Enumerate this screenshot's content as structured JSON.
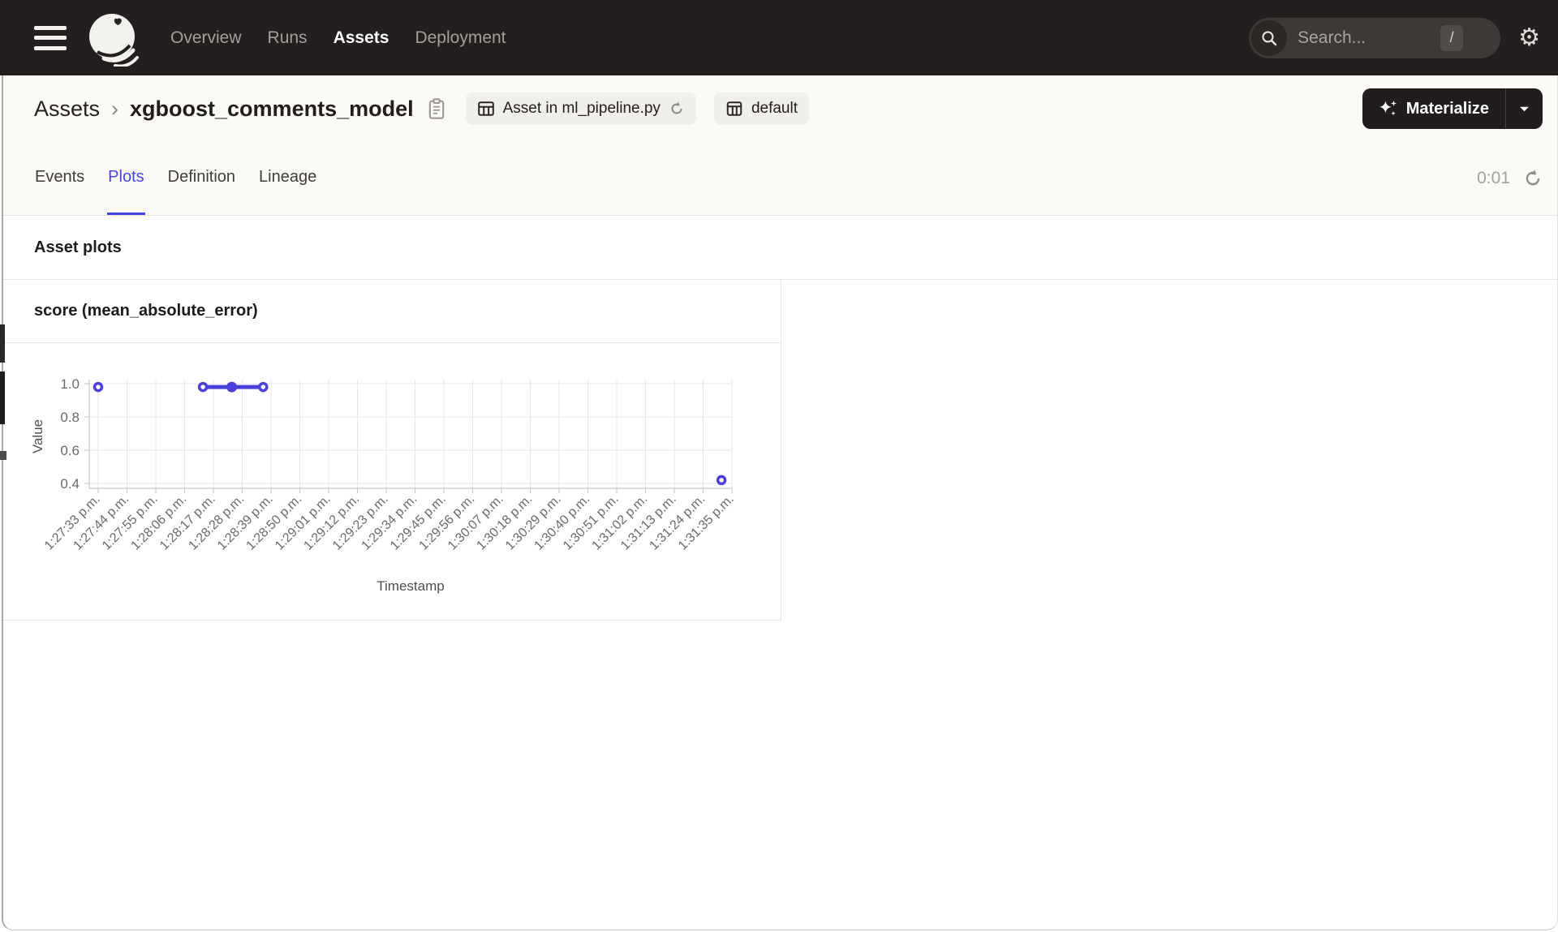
{
  "topnav": {
    "items": [
      {
        "label": "Overview",
        "active": false
      },
      {
        "label": "Runs",
        "active": false
      },
      {
        "label": "Assets",
        "active": true
      },
      {
        "label": "Deployment",
        "active": false
      }
    ],
    "search": {
      "placeholder": "Search...",
      "shortcut": "/"
    }
  },
  "header": {
    "breadcrumb": {
      "root": "Assets",
      "separator": "›",
      "current": "xgboost_comments_model"
    },
    "source_badge": {
      "label": "Asset in ml_pipeline.py"
    },
    "group_badge": {
      "label": "default"
    },
    "materialize_button": {
      "label": "Materialize"
    }
  },
  "tabs": {
    "items": [
      {
        "label": "Events",
        "active": false
      },
      {
        "label": "Plots",
        "active": true
      },
      {
        "label": "Definition",
        "active": false
      },
      {
        "label": "Lineage",
        "active": false
      }
    ],
    "timer": "0:01"
  },
  "main": {
    "section_title": "Asset plots",
    "card_title": "score (mean_absolute_error)"
  },
  "chart_data": {
    "type": "line",
    "title": "score (mean_absolute_error)",
    "xlabel": "Timestamp",
    "ylabel": "Value",
    "grid": true,
    "legend": false,
    "y_ticks": [
      "1.0",
      "0.8",
      "0.6",
      "0.4"
    ],
    "y_tick_values": [
      1.0,
      0.8,
      0.6,
      0.4
    ],
    "ylim": [
      0.35,
      1.02
    ],
    "x_tick_labels": [
      "1:27:33 p.m.",
      "1:27:44 p.m.",
      "1:27:55 p.m.",
      "1:28:06 p.m.",
      "1:28:17 p.m.",
      "1:28:28 p.m.",
      "1:28:39 p.m.",
      "1:28:50 p.m.",
      "1:29:01 p.m.",
      "1:29:12 p.m.",
      "1:29:23 p.m.",
      "1:29:34 p.m.",
      "1:29:45 p.m.",
      "1:29:56 p.m.",
      "1:30:07 p.m.",
      "1:30:18 p.m.",
      "1:30:29 p.m.",
      "1:30:40 p.m.",
      "1:30:51 p.m.",
      "1:31:02 p.m.",
      "1:31:13 p.m.",
      "1:31:24 p.m.",
      "1:31:35 p.m."
    ],
    "x_tick_interval_seconds": 11,
    "x_range_seconds": [
      0,
      242
    ],
    "series": [
      {
        "name": "score",
        "color": "#4B40D8",
        "points": [
          {
            "time": "1:27:33 p.m.",
            "t": 0,
            "value": 0.98,
            "style": "open",
            "segment": 0
          },
          {
            "time": "1:28:13 p.m.",
            "t": 40,
            "value": 0.98,
            "style": "open",
            "segment": 1
          },
          {
            "time": "1:28:24 p.m.",
            "t": 51,
            "value": 0.98,
            "style": "filled",
            "segment": 1
          },
          {
            "time": "1:28:36 p.m.",
            "t": 63,
            "value": 0.98,
            "style": "open",
            "segment": 1
          },
          {
            "time": "1:31:31 p.m.",
            "t": 238,
            "value": 0.42,
            "style": "open",
            "segment": 2
          }
        ]
      }
    ]
  },
  "colors": {
    "accent": "#4645E2",
    "series": "#4B40D8",
    "topnav_bg": "#231F1E",
    "header_bg": "#FBFAF7",
    "border": "#E8E6E3",
    "grid": "#E7E7E7",
    "axis": "#C6C6C6",
    "tick_text": "#6A6A6A"
  }
}
